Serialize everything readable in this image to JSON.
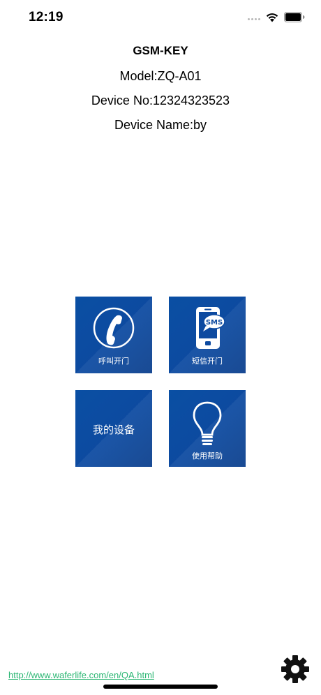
{
  "status_bar": {
    "time": "12:19"
  },
  "header": {
    "title": "GSM-KEY",
    "model": "Model:ZQ-A01",
    "device_no": "Device No:12324323523",
    "device_name": "Device Name:by"
  },
  "tiles": [
    {
      "label": "呼叫开门",
      "icon": "phone-handset-icon"
    },
    {
      "label": "短信开门",
      "icon": "sms-phone-icon",
      "icon_text": "SMS"
    },
    {
      "label": "我的设备",
      "icon": "none"
    },
    {
      "label": "使用帮助",
      "icon": "light-bulb-icon"
    }
  ],
  "footer": {
    "link_text": "http://www.waferlife.com/en/QA.html"
  },
  "colors": {
    "tile_blue": "#0d4aa0",
    "link_green": "#2bb673"
  }
}
